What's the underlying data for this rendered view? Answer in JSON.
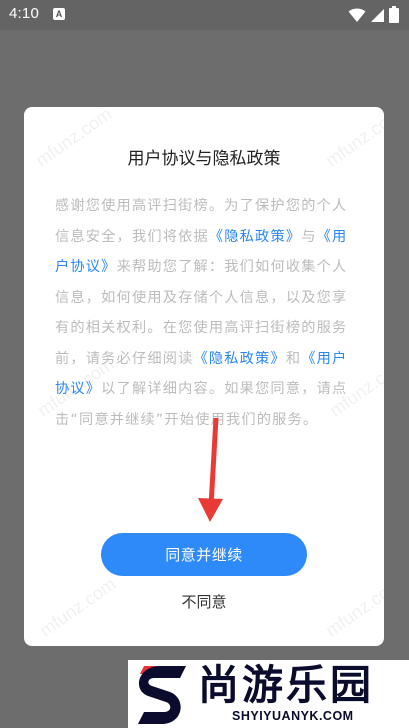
{
  "status_bar": {
    "time": "4:10",
    "notification_icon_letter": "A",
    "icons": [
      "a-notification-icon",
      "wifi-icon",
      "cellular-signal-icon",
      "battery-icon"
    ]
  },
  "dialog": {
    "title": "用户协议与隐私政策",
    "body": {
      "part1": "感谢您使用高评扫街榜。为了保护您的个人信息安全，我们将依据",
      "privacy_link_1": "《隐私政策》",
      "part2": "与",
      "user_agreement_link_1": "《用户协议》",
      "part3": "来帮助您了解：我们如何收集个人信息，如何使用及存储个人信息，以及您享有的相关权利。在您使用高评扫街榜的服务前，请务必仔细阅读",
      "privacy_link_2": "《隐私政策》",
      "part4": "和",
      "user_agreement_link_2": "《用户协议》",
      "part5": "以了解详细内容。如果您同意，请点击“同意并继续”开始使用我们的服务。"
    },
    "agree_button_label": "同意并继续",
    "disagree_button_label": "不同意"
  },
  "watermark": {
    "text": "mfunz.com"
  },
  "brand_overlay": {
    "name": "尚游乐园",
    "url": "SHYIYUANYK.COM"
  },
  "colors": {
    "overlay_background": "#6d6d6d",
    "status_bar_background": "#646464",
    "dialog_background": "#ffffff",
    "link_blue": "#2a86f5",
    "button_blue": "#2d8af8",
    "body_text": "#bcbcbc",
    "annotation_arrow": "#e83b35",
    "brand_navy": "#0b0b2e",
    "brand_red": "#e8343a"
  }
}
